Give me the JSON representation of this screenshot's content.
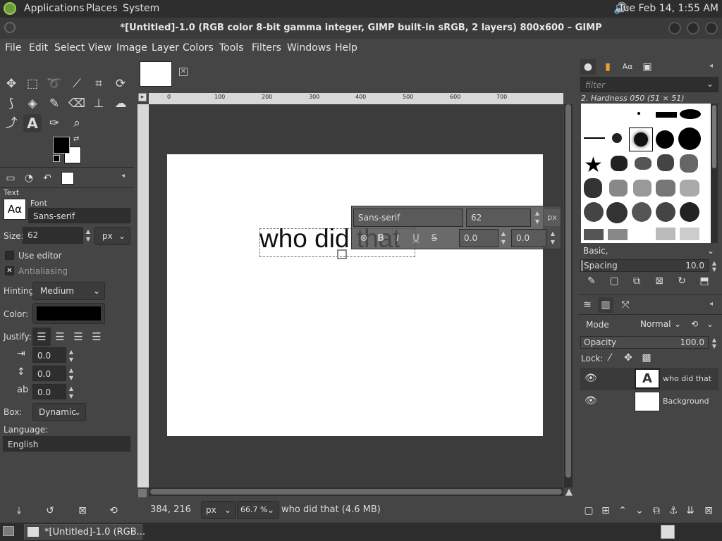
{
  "system": {
    "menus": [
      "Applications",
      "Places",
      "System"
    ],
    "clock": "Tue Feb 14,  1:55 AM"
  },
  "window": {
    "title": "*[Untitled]-1.0 (RGB color 8-bit gamma integer, GIMP built-in sRGB, 2 layers) 800x600 – GIMP"
  },
  "menubar": [
    "File",
    "Edit",
    "Select",
    "View",
    "Image",
    "Layer",
    "Colors",
    "Tools",
    "Filters",
    "Windows",
    "Help"
  ],
  "tool_options": {
    "section_title": "Text",
    "font_label": "Font",
    "font_value": "Sans-serif",
    "font_preview": "Aα",
    "size_label": "Size:",
    "size_value": "62",
    "size_unit": "px",
    "use_editor": "Use editor",
    "antialiasing": "Antialiasing",
    "hinting_label": "Hinting:",
    "hinting_value": "Medium",
    "color_label": "Color:",
    "color_value": "#000000",
    "justify_label": "Justify:",
    "indent_value": "0.0",
    "line_spacing_value": "0.0",
    "letter_spacing_value": "0.0",
    "box_label": "Box:",
    "box_value": "Dynamic",
    "language_label": "Language:",
    "language_value": "English"
  },
  "canvas": {
    "text_layer": "who did that",
    "ruler_marks": [
      "0",
      "100",
      "200",
      "300",
      "400",
      "500",
      "600",
      "700"
    ],
    "floating_toolbar": {
      "font": "Sans-serif",
      "size": "62",
      "unit": "px",
      "baseline": "0.0",
      "kerning": "0.0"
    }
  },
  "brushes": {
    "filter_placeholder": "filter",
    "current": "2. Hardness 050 (51 × 51)",
    "preset": "Basic,",
    "spacing_label": "Spacing",
    "spacing_value": "10.0"
  },
  "layers": {
    "mode_label": "Mode",
    "mode_value": "Normal",
    "opacity_label": "Opacity",
    "opacity_value": "100.0",
    "lock_label": "Lock:",
    "items": [
      {
        "name": "who did that",
        "type": "text"
      },
      {
        "name": "Background",
        "type": "image"
      }
    ]
  },
  "statusbar": {
    "coords": "384, 216",
    "unit": "px",
    "zoom": "66.7 %",
    "info": "who did that (4.6 MB)"
  },
  "taskbar": {
    "item": "*[Untitled]-1.0 (RGB..."
  }
}
